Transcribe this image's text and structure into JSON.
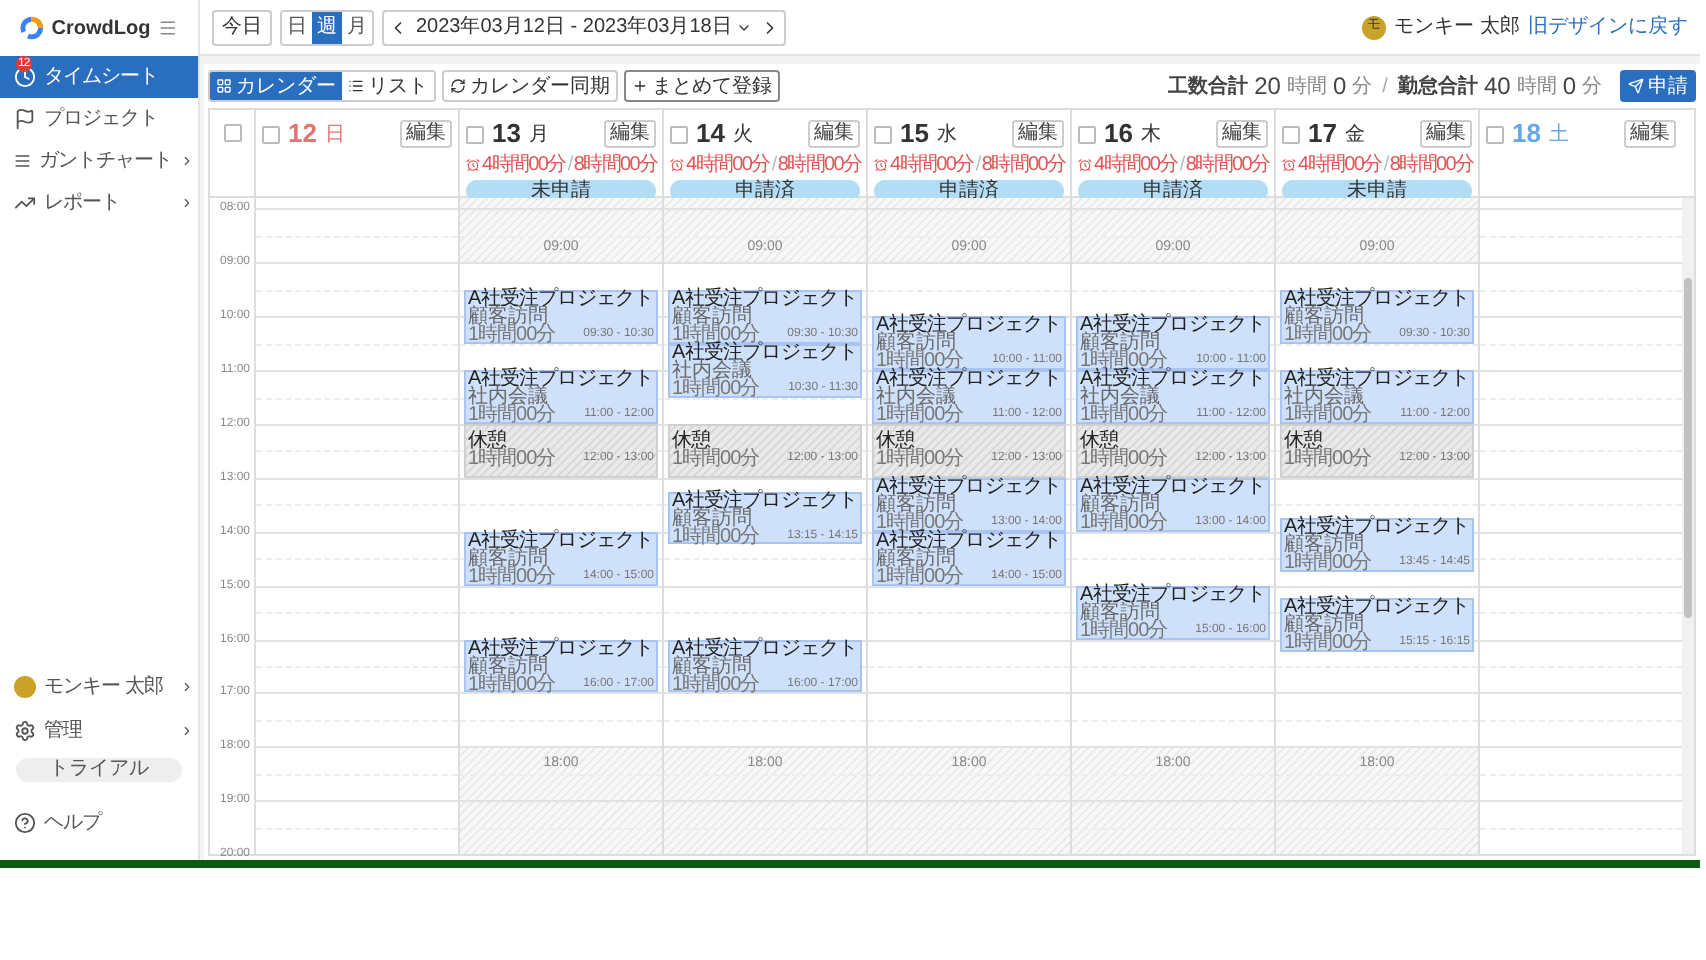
{
  "app": {
    "name": "CrowdLog"
  },
  "sidebar": {
    "items": [
      {
        "label": "タイムシート",
        "selected": true,
        "badge": "12",
        "expandable": false
      },
      {
        "label": "プロジェクト",
        "selected": false,
        "expandable": false
      },
      {
        "label": "ガントチャート",
        "selected": false,
        "expandable": true
      },
      {
        "label": "レポート",
        "selected": false,
        "expandable": true
      }
    ],
    "bottom_items": [
      {
        "kind": "user",
        "label": "モンキー 太郎",
        "expandable": true
      },
      {
        "kind": "settings",
        "label": "管理",
        "expandable": true
      },
      {
        "kind": "trial",
        "label": "トライアル"
      },
      {
        "kind": "help",
        "label": "ヘルプ"
      }
    ]
  },
  "topbar": {
    "today": "今日",
    "views": [
      {
        "label": "日",
        "selected": false
      },
      {
        "label": "週",
        "selected": true
      },
      {
        "label": "月",
        "selected": false
      }
    ],
    "date_range": "2023年03月12日 - 2023年03月18日",
    "user": {
      "avatar": "モ",
      "name": "モンキー 太郎"
    },
    "old_design_link": "旧デザインに戻す"
  },
  "toolbar": {
    "modes": [
      {
        "label": "カレンダー",
        "selected": true
      },
      {
        "label": "リスト",
        "selected": false
      }
    ],
    "actions": [
      "カレンダー同期",
      "まとめて登録"
    ],
    "totals": [
      {
        "label": "工数合計",
        "hours": "20",
        "hours_unit": "時間",
        "minutes": "0",
        "minutes_unit": "分"
      },
      {
        "label": "勤怠合計",
        "hours": "40",
        "hours_unit": "時間",
        "minutes": "0",
        "minutes_unit": "分"
      }
    ],
    "totals_separator": "/",
    "submit": "申請"
  },
  "calendar": {
    "select_all": {
      "checked": false
    },
    "hours": [
      "08:00",
      "09:00",
      "10:00",
      "11:00",
      "12:00",
      "13:00",
      "14:00",
      "15:00",
      "16:00",
      "17:00",
      "18:00",
      "19:00",
      "20:00"
    ],
    "days": [
      {
        "kind": "sunday",
        "number": "12",
        "weekday": "日",
        "checked": false,
        "edit": "編集"
      },
      {
        "kind": "weekday",
        "number": "13",
        "weekday": "月",
        "checked": false,
        "edit": "編集",
        "summary": {
          "worked": "4時間00分",
          "separator": "/",
          "scheduled": "8時間00分"
        },
        "status": "未申請",
        "start_marker": "09:00",
        "end_marker": "18:00",
        "events": [
          {
            "kind": "work",
            "title": "A社受注プロジェクト",
            "task": "顧客訪問",
            "duration": "1時間00分",
            "time": "09:30 - 10:30"
          },
          {
            "kind": "work",
            "title": "A社受注プロジェクト",
            "task": "社内会議",
            "duration": "1時間00分",
            "time": "11:00 - 12:00"
          },
          {
            "kind": "break",
            "title": "休憩",
            "duration": "1時間00分",
            "time": "12:00 - 13:00"
          },
          {
            "kind": "work",
            "title": "A社受注プロジェクト",
            "task": "顧客訪問",
            "duration": "1時間00分",
            "time": "14:00 - 15:00"
          },
          {
            "kind": "work",
            "title": "A社受注プロジェクト",
            "task": "顧客訪問",
            "duration": "1時間00分",
            "time": "16:00 - 17:00"
          }
        ]
      },
      {
        "kind": "weekday",
        "number": "14",
        "weekday": "火",
        "checked": false,
        "edit": "編集",
        "summary": {
          "worked": "4時間00分",
          "separator": "/",
          "scheduled": "8時間00分"
        },
        "status": "申請済",
        "start_marker": "09:00",
        "end_marker": "18:00",
        "events": [
          {
            "kind": "work",
            "title": "A社受注プロジェクト",
            "task": "顧客訪問",
            "duration": "1時間00分",
            "time": "09:30 - 10:30"
          },
          {
            "kind": "work",
            "title": "A社受注プロジェクト",
            "task": "社内会議",
            "duration": "1時間00分",
            "time": "10:30 - 11:30"
          },
          {
            "kind": "break",
            "title": "休憩",
            "duration": "1時間00分",
            "time": "12:00 - 13:00"
          },
          {
            "kind": "work",
            "title": "A社受注プロジェクト",
            "task": "顧客訪問",
            "duration": "1時間00分",
            "time": "13:15 - 14:15"
          },
          {
            "kind": "work",
            "title": "A社受注プロジェクト",
            "task": "顧客訪問",
            "duration": "1時間00分",
            "time": "16:00 - 17:00"
          }
        ]
      },
      {
        "kind": "weekday",
        "number": "15",
        "weekday": "水",
        "checked": false,
        "edit": "編集",
        "summary": {
          "worked": "4時間00分",
          "separator": "/",
          "scheduled": "8時間00分"
        },
        "status": "申請済",
        "start_marker": "09:00",
        "end_marker": "18:00",
        "events": [
          {
            "kind": "work",
            "title": "A社受注プロジェクト",
            "task": "顧客訪問",
            "duration": "1時間00分",
            "time": "10:00 - 11:00"
          },
          {
            "kind": "work",
            "title": "A社受注プロジェクト",
            "task": "社内会議",
            "duration": "1時間00分",
            "time": "11:00 - 12:00"
          },
          {
            "kind": "break",
            "title": "休憩",
            "duration": "1時間00分",
            "time": "12:00 - 13:00"
          },
          {
            "kind": "work",
            "title": "A社受注プロジェクト",
            "task": "顧客訪問",
            "duration": "1時間00分",
            "time": "13:00 - 14:00"
          },
          {
            "kind": "work",
            "title": "A社受注プロジェクト",
            "task": "顧客訪問",
            "duration": "1時間00分",
            "time": "14:00 - 15:00"
          }
        ]
      },
      {
        "kind": "weekday",
        "number": "16",
        "weekday": "木",
        "checked": false,
        "edit": "編集",
        "summary": {
          "worked": "4時間00分",
          "separator": "/",
          "scheduled": "8時間00分"
        },
        "status": "申請済",
        "start_marker": "09:00",
        "end_marker": "18:00",
        "events": [
          {
            "kind": "work",
            "title": "A社受注プロジェクト",
            "task": "顧客訪問",
            "duration": "1時間00分",
            "time": "10:00 - 11:00"
          },
          {
            "kind": "work",
            "title": "A社受注プロジェクト",
            "task": "社内会議",
            "duration": "1時間00分",
            "time": "11:00 - 12:00"
          },
          {
            "kind": "break",
            "title": "休憩",
            "duration": "1時間00分",
            "time": "12:00 - 13:00"
          },
          {
            "kind": "work",
            "title": "A社受注プロジェクト",
            "task": "顧客訪問",
            "duration": "1時間00分",
            "time": "13:00 - 14:00"
          },
          {
            "kind": "work",
            "title": "A社受注プロジェクト",
            "task": "顧客訪問",
            "duration": "1時間00分",
            "time": "15:00 - 16:00"
          }
        ]
      },
      {
        "kind": "weekday",
        "number": "17",
        "weekday": "金",
        "checked": false,
        "edit": "編集",
        "summary": {
          "worked": "4時間00分",
          "separator": "/",
          "scheduled": "8時間00分"
        },
        "status": "未申請",
        "start_marker": "09:00",
        "end_marker": "18:00",
        "events": [
          {
            "kind": "work",
            "title": "A社受注プロジェクト",
            "task": "顧客訪問",
            "duration": "1時間00分",
            "time": "09:30 - 10:30"
          },
          {
            "kind": "work",
            "title": "A社受注プロジェクト",
            "task": "社内会議",
            "duration": "1時間00分",
            "time": "11:00 - 12:00"
          },
          {
            "kind": "break",
            "title": "休憩",
            "duration": "1時間00分",
            "time": "12:00 - 13:00"
          },
          {
            "kind": "work",
            "title": "A社受注プロジェクト",
            "task": "顧客訪問",
            "duration": "1時間00分",
            "time": "13:45 - 14:45"
          },
          {
            "kind": "work",
            "title": "A社受注プロジェクト",
            "task": "顧客訪問",
            "duration": "1時間00分",
            "time": "15:15 - 16:15"
          }
        ]
      },
      {
        "kind": "saturday",
        "number": "18",
        "weekday": "土",
        "checked": false,
        "edit": "編集"
      }
    ]
  }
}
